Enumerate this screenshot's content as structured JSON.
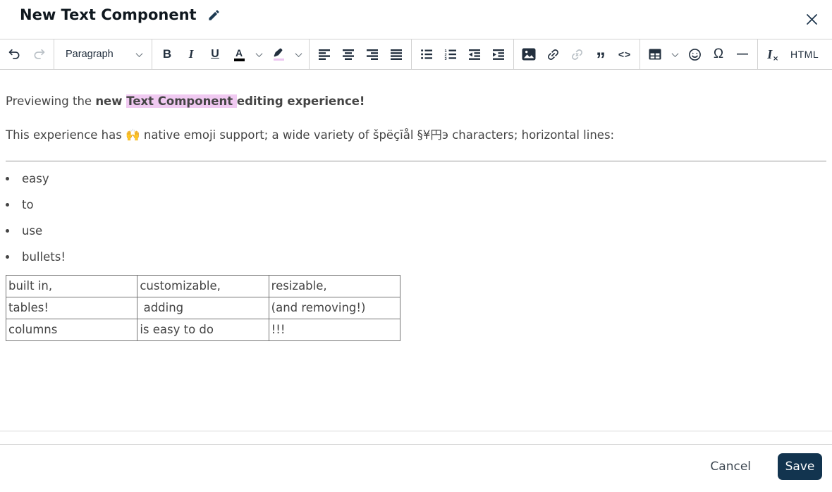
{
  "header": {
    "title": "New Text Component"
  },
  "toolbar": {
    "paragraph_dropdown": "Paragraph",
    "bold_glyph": "B",
    "italic_glyph": "I",
    "underline_glyph": "U",
    "text_color_glyph": "A",
    "quote_glyph": "”",
    "code_glyph": "<>",
    "omega_glyph": "Ω",
    "hr_glyph": "—",
    "clear_format_glyph": "I",
    "clear_format_sub": "×",
    "html_label": "HTML"
  },
  "content": {
    "paragraph1": {
      "normal": "Previewing the ",
      "bold_1": "new ",
      "highlighted": "Text Component ",
      "bold_2": "editing experience!"
    },
    "paragraph2": "This experience has 🙌 native emoji support; a wide variety of špëçīål §¥円э characters; horizontal lines:",
    "bullets": [
      "easy",
      "to",
      "use",
      "bullets!"
    ],
    "table": {
      "rows": [
        [
          "built in,",
          "customizable,",
          "resizable,"
        ],
        [
          "tables!",
          " adding",
          "(and removing!)"
        ],
        [
          "columns",
          "is easy to do",
          "!!!"
        ]
      ]
    }
  },
  "footer": {
    "cancel": "Cancel",
    "save": "Save"
  },
  "colors": {
    "accent": "#12344f",
    "icon": "#222f3e",
    "icon_disabled": "#b9c0c6",
    "highlight": "#f0c9f1",
    "body_text": "#444444",
    "toolbar_border": "#d2d2d2",
    "table_border": "#757575"
  }
}
